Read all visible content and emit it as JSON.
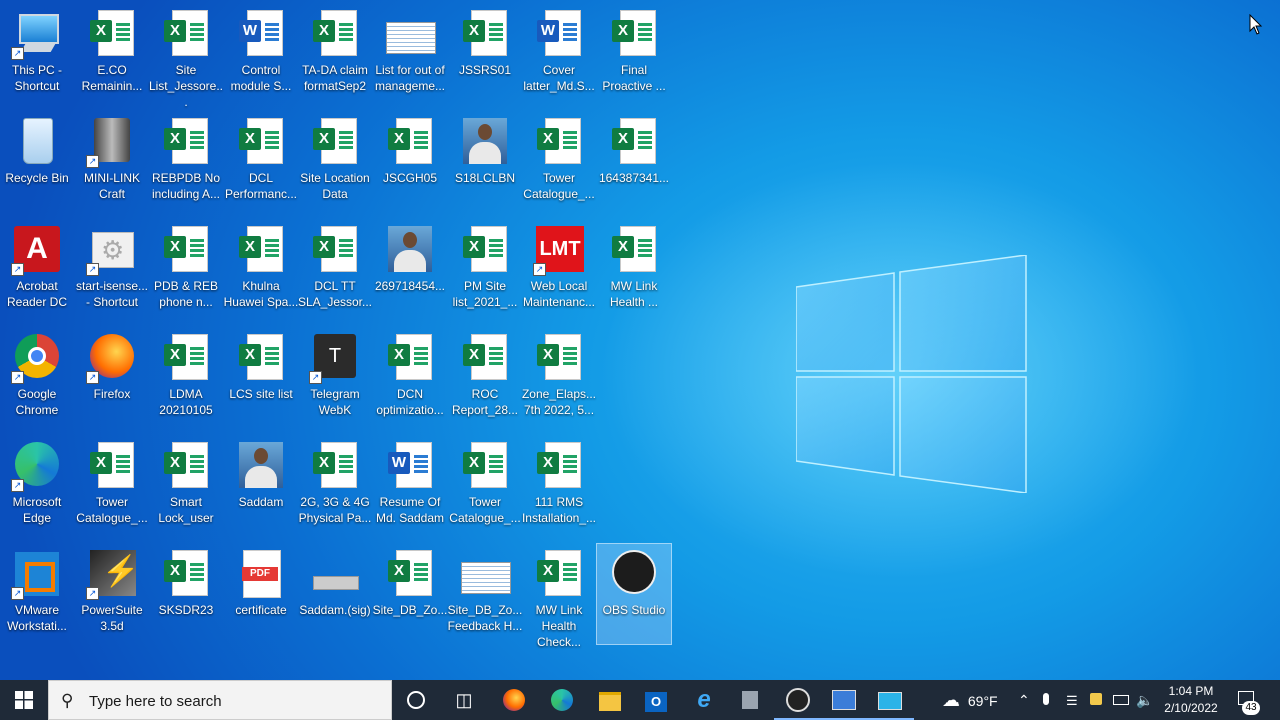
{
  "desktop": {
    "icons": [
      {
        "label": "This PC - Shortcut",
        "type": "pc",
        "shortcut": true
      },
      {
        "label": "E.CO Remainin...",
        "type": "excel"
      },
      {
        "label": "Site List_Jessore...",
        "type": "excel"
      },
      {
        "label": "Control module S...",
        "type": "word"
      },
      {
        "label": "TA-DA claim formatSep2",
        "type": "excel"
      },
      {
        "label": "List for out of manageme...",
        "type": "sheet"
      },
      {
        "label": "JSSRS01",
        "type": "excel"
      },
      {
        "label": "Cover latter_Md.S...",
        "type": "word"
      },
      {
        "label": "Final Proactive ...",
        "type": "excel"
      },
      {
        "label": "Recycle Bin",
        "type": "recycle"
      },
      {
        "label": "MINI-LINK Craft",
        "type": "minilink",
        "shortcut": true
      },
      {
        "label": "REBPDB No including A...",
        "type": "excel"
      },
      {
        "label": "DCL Performanc...",
        "type": "excel"
      },
      {
        "label": "Site Location Data",
        "type": "excel"
      },
      {
        "label": "JSCGH05",
        "type": "excel"
      },
      {
        "label": "S18LCLBN",
        "type": "photo"
      },
      {
        "label": "Tower Catalogue_...",
        "type": "excel"
      },
      {
        "label": "164387341...",
        "type": "excel"
      },
      {
        "label": "Acrobat Reader DC",
        "type": "acrobat",
        "shortcut": true
      },
      {
        "label": "start-isense... - Shortcut",
        "type": "gear",
        "shortcut": true
      },
      {
        "label": "PDB & REB phone n...",
        "type": "excel"
      },
      {
        "label": "Khulna Huawei Spa...",
        "type": "excel"
      },
      {
        "label": "DCL TT SLA_Jessor...",
        "type": "excel"
      },
      {
        "label": "269718454...",
        "type": "photo"
      },
      {
        "label": "PM Site list_2021_...",
        "type": "excel"
      },
      {
        "label": "Web Local Maintenanc...",
        "type": "lmt",
        "shortcut": true
      },
      {
        "label": "MW Link Health ...",
        "type": "excel"
      },
      {
        "label": "Google Chrome",
        "type": "chrome",
        "shortcut": true
      },
      {
        "label": "Firefox",
        "type": "firefox",
        "shortcut": true
      },
      {
        "label": "LDMA 20210105",
        "type": "excel"
      },
      {
        "label": "LCS site list",
        "type": "excel"
      },
      {
        "label": "Telegram WebK",
        "type": "telegram",
        "shortcut": true
      },
      {
        "label": "DCN optimizatio...",
        "type": "excel"
      },
      {
        "label": "ROC Report_28...",
        "type": "excel"
      },
      {
        "label": "Zone_Elaps... 7th 2022, 5...",
        "type": "excel"
      },
      {
        "label": "Microsoft Edge",
        "type": "edge",
        "shortcut": true
      },
      {
        "label": "Tower Catalogue_...",
        "type": "excel"
      },
      {
        "label": "Smart Lock_user",
        "type": "excel"
      },
      {
        "label": "Saddam",
        "type": "photo"
      },
      {
        "label": "2G, 3G & 4G Physical Pa...",
        "type": "excel"
      },
      {
        "label": "Resume Of Md. Saddam",
        "type": "word"
      },
      {
        "label": "Tower Catalogue_...",
        "type": "excel"
      },
      {
        "label": "111 RMS Installation_...",
        "type": "excel"
      },
      {
        "label": "VMware Workstati...",
        "type": "vmware",
        "shortcut": true
      },
      {
        "label": "PowerSuite 3.5d",
        "type": "powersuite",
        "shortcut": true
      },
      {
        "label": "SKSDR23",
        "type": "excel"
      },
      {
        "label": "certificate",
        "type": "pdf"
      },
      {
        "label": "Saddam.(sig)",
        "type": "sig"
      },
      {
        "label": "Site_DB_Zo...",
        "type": "excel"
      },
      {
        "label": "Site_DB_Zo... Feedback H...",
        "type": "sheet"
      },
      {
        "label": "MW Link Health Check...",
        "type": "excel"
      },
      {
        "label": "OBS Studio",
        "type": "obs",
        "selected": true
      }
    ]
  },
  "taskbar": {
    "search_placeholder": "Type here to search",
    "pinned": [
      "cortana-icon",
      "task-view-icon",
      "firefox-icon",
      "edge-icon",
      "file-explorer-icon",
      "outlook-icon",
      "internet-explorer-icon",
      "app-icon",
      "obs-icon",
      "app2-icon",
      "app3-icon"
    ],
    "weather": "69°F",
    "time": "1:04 PM",
    "date": "2/10/2022",
    "notification_count": "43"
  }
}
